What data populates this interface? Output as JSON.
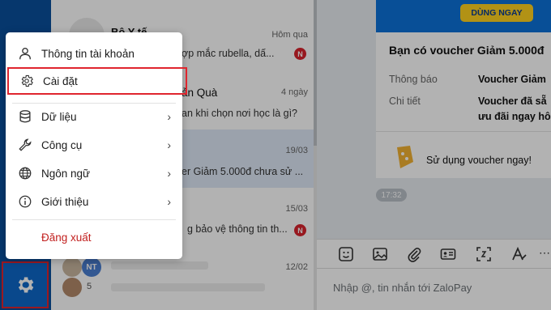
{
  "conversations": [
    {
      "name": "Bộ Y tế",
      "time": "Hôm qua",
      "preview": "ợp mắc rubella, dấ...",
      "badge": "N"
    },
    {
      "name": "ản Quà",
      "time": "4 ngày",
      "preview": "an khi chọn nơi học là gì?"
    },
    {
      "time": "19/03",
      "preview": "er Giảm 5.000đ chưa sử ..."
    },
    {
      "time": "15/03",
      "preview": "g bảo vệ thông tin th...",
      "badge": "N"
    },
    {
      "time": "12/02",
      "avatar_initials": "NT",
      "count": "5"
    }
  ],
  "promo": {
    "button_label": "DÙNG NGAY"
  },
  "voucher_card": {
    "title": "Bạn có voucher Giảm 5.000đ",
    "rows": [
      {
        "label": "Thông báo",
        "value": "Voucher Giảm"
      },
      {
        "label": "Chi tiết",
        "value": "Voucher đã sẵ",
        "value2": "ưu đãi ngay hô"
      }
    ],
    "action": "Sử dụng voucher ngay!"
  },
  "chat_time": "17:32",
  "composer": {
    "placeholder": "Nhập @, tin nhắn tới ZaloPay"
  },
  "menu": {
    "items": [
      {
        "label": "Thông tin tài khoản",
        "icon": "user-icon"
      },
      {
        "label": "Cài đặt",
        "icon": "settings-icon"
      },
      {
        "label": "Dữ liệu",
        "icon": "database-icon"
      },
      {
        "label": "Công cụ",
        "icon": "wrench-icon"
      },
      {
        "label": "Ngôn ngữ",
        "icon": "globe-icon"
      },
      {
        "label": "Giới thiệu",
        "icon": "info-icon"
      }
    ],
    "logout": "Đăng xuất"
  },
  "colors": {
    "nav": "#0a4f9c",
    "highlight": "#e0252e",
    "logout": "#c2201f",
    "promo": "#0c72d8"
  }
}
